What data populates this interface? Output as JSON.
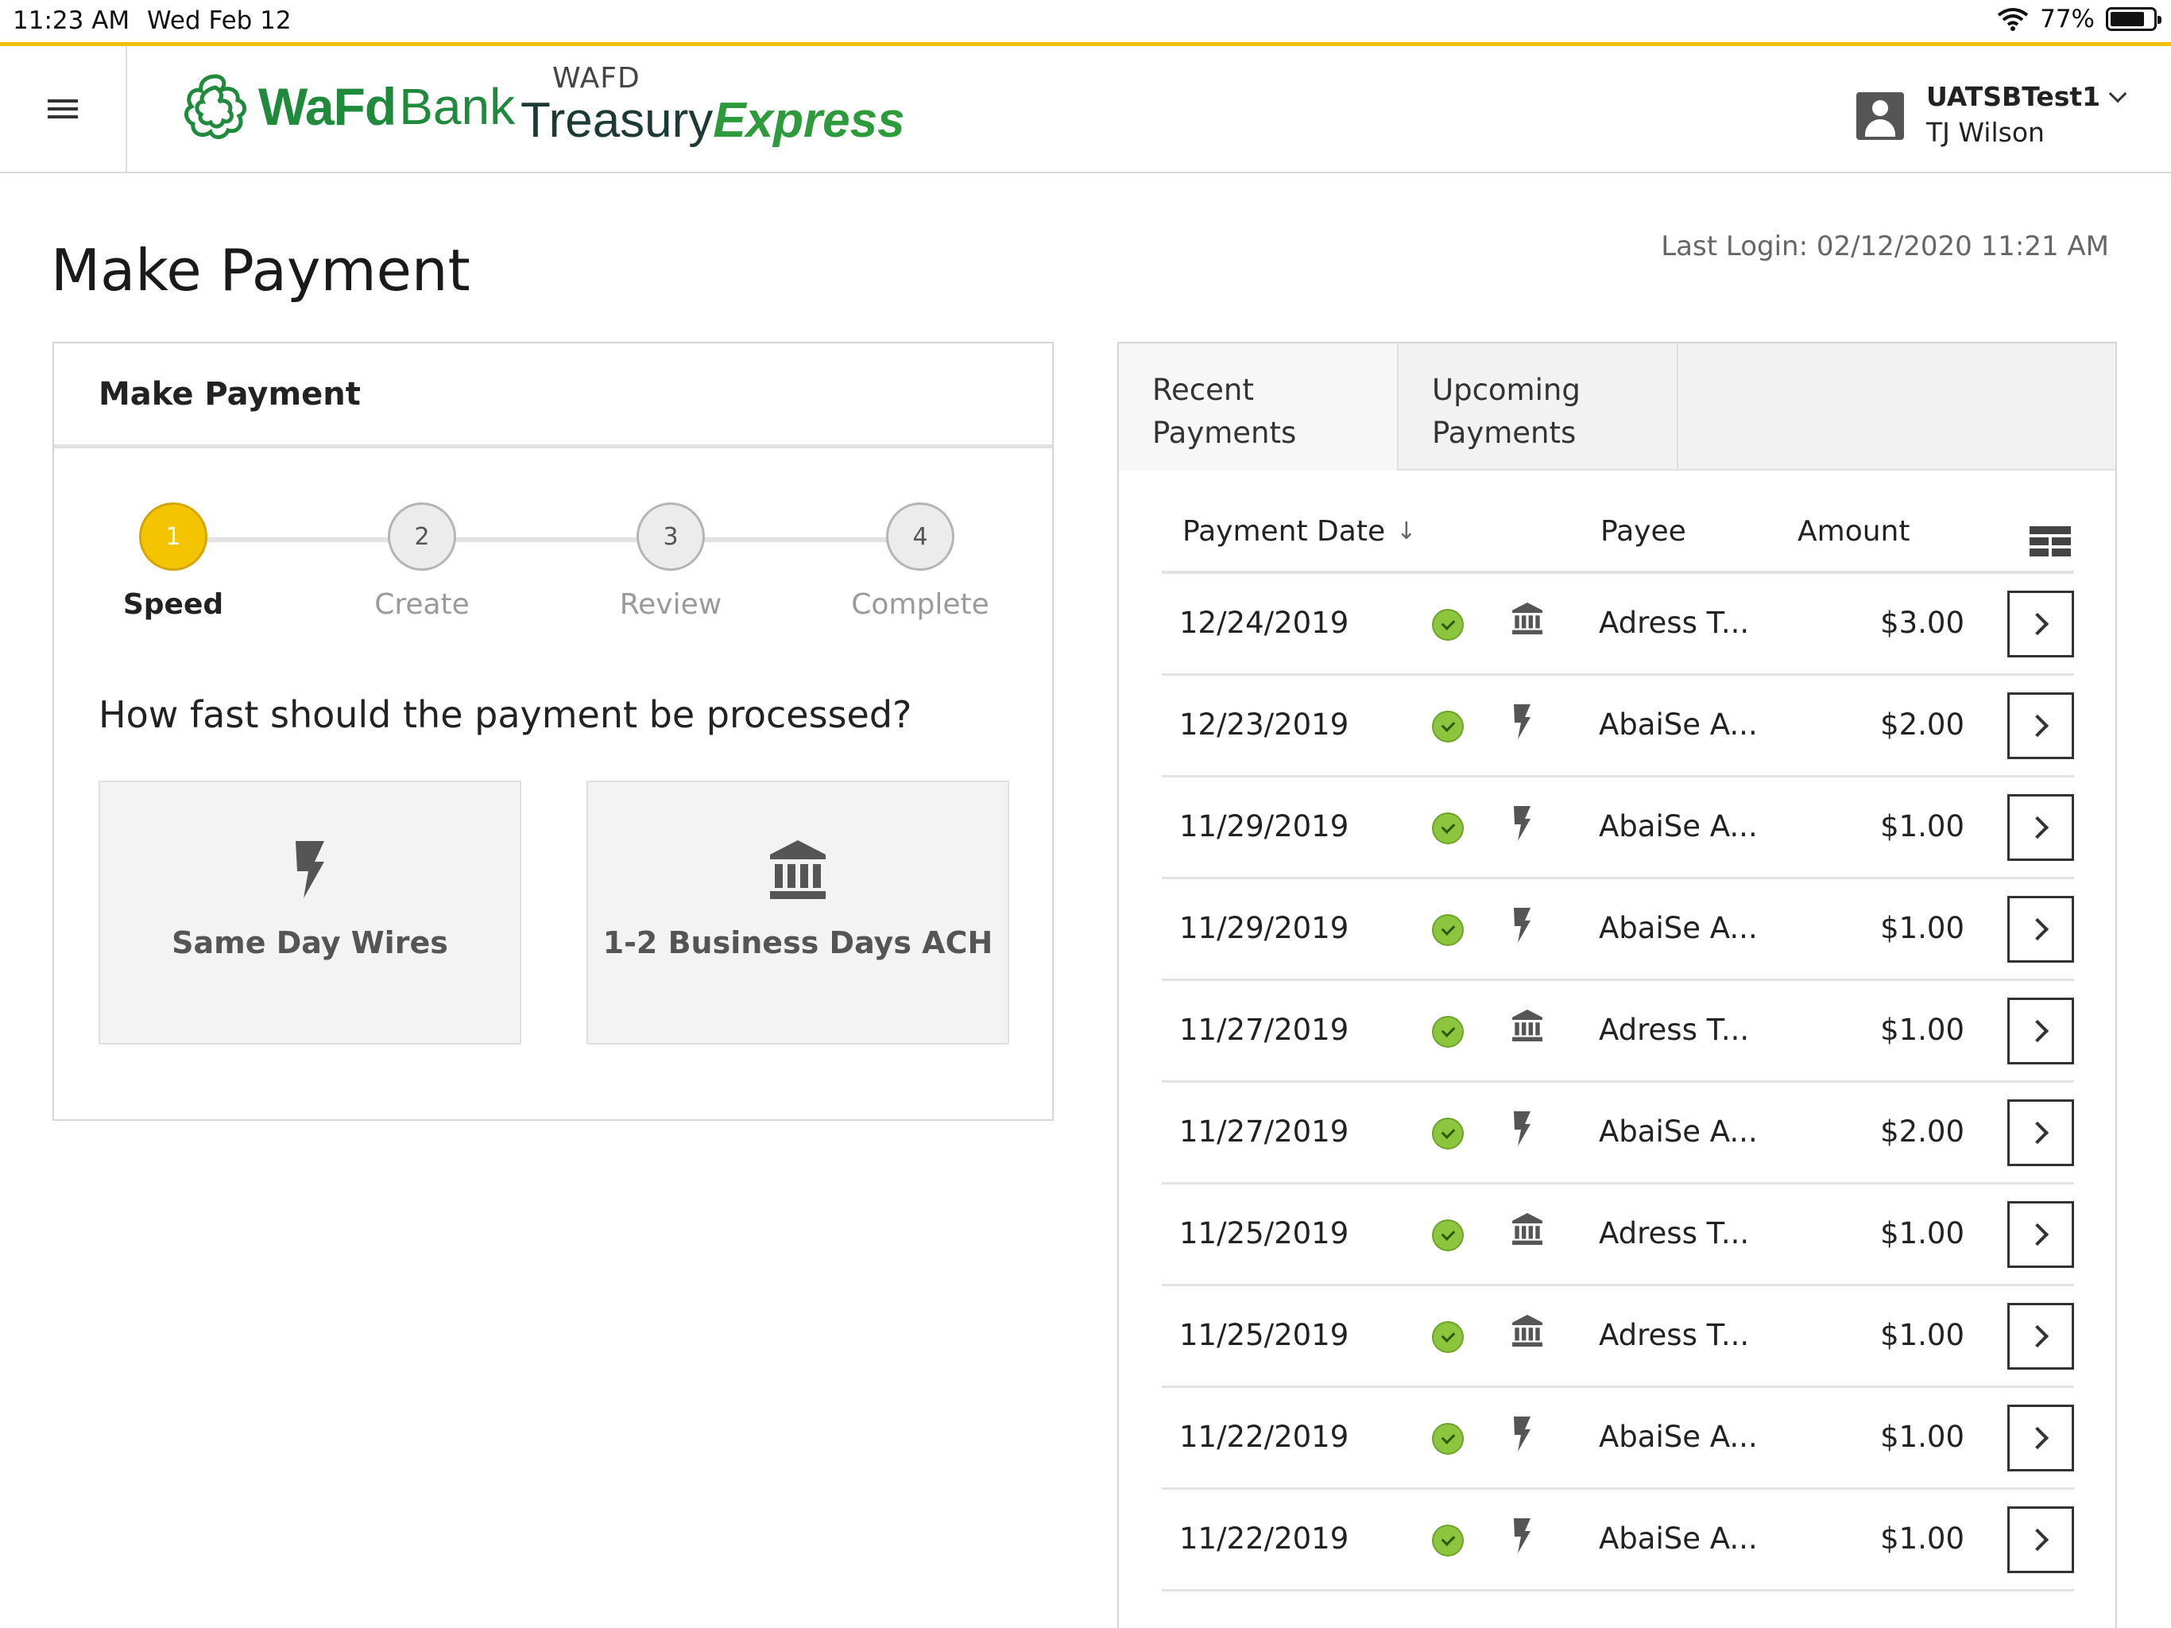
{
  "status_bar": {
    "time": "11:23 AM",
    "date": "Wed Feb 12",
    "battery": "77%"
  },
  "header": {
    "logo_wafd": "WaFd",
    "logo_bank": "Bank",
    "treasury_small": "WAFD",
    "treasury_main": "Treasury",
    "treasury_express": "Express",
    "user_id": "UATSBTest1",
    "user_name": "TJ Wilson"
  },
  "page": {
    "title": "Make Payment",
    "last_login": "Last Login: 02/12/2020 11:21 AM"
  },
  "make_payment_card": {
    "title": "Make Payment",
    "steps": [
      {
        "number": "1",
        "label": "Speed",
        "active": true
      },
      {
        "number": "2",
        "label": "Create",
        "active": false
      },
      {
        "number": "3",
        "label": "Review",
        "active": false
      },
      {
        "number": "4",
        "label": "Complete",
        "active": false
      }
    ],
    "question": "How fast should the payment be processed?",
    "options": [
      {
        "label": "Same Day Wires",
        "icon": "lightning-icon"
      },
      {
        "label": "1-2 Business Days ACH",
        "icon": "bank-icon"
      }
    ]
  },
  "payments_panel": {
    "tabs": [
      {
        "line1": "Recent",
        "line2": "Payments"
      },
      {
        "line1": "Upcoming",
        "line2": "Payments"
      }
    ],
    "columns": {
      "date": "Payment Date",
      "payee": "Payee",
      "amount": "Amount"
    },
    "rows": [
      {
        "date": "12/24/2019",
        "type": "bank-icon",
        "payee": "Adress T...",
        "amount": "$3.00"
      },
      {
        "date": "12/23/2019",
        "type": "lightning-icon",
        "payee": "AbaiSe A...",
        "amount": "$2.00"
      },
      {
        "date": "11/29/2019",
        "type": "lightning-icon",
        "payee": "AbaiSe A...",
        "amount": "$1.00"
      },
      {
        "date": "11/29/2019",
        "type": "lightning-icon",
        "payee": "AbaiSe A...",
        "amount": "$1.00"
      },
      {
        "date": "11/27/2019",
        "type": "bank-icon",
        "payee": "Adress T...",
        "amount": "$1.00"
      },
      {
        "date": "11/27/2019",
        "type": "lightning-icon",
        "payee": "AbaiSe A...",
        "amount": "$2.00"
      },
      {
        "date": "11/25/2019",
        "type": "bank-icon",
        "payee": "Adress T...",
        "amount": "$1.00"
      },
      {
        "date": "11/25/2019",
        "type": "bank-icon",
        "payee": "Adress T...",
        "amount": "$1.00"
      },
      {
        "date": "11/22/2019",
        "type": "lightning-icon",
        "payee": "AbaiSe A...",
        "amount": "$1.00"
      },
      {
        "date": "11/22/2019",
        "type": "lightning-icon",
        "payee": "AbaiSe A...",
        "amount": "$1.00"
      }
    ]
  },
  "colors": {
    "accent_yellow": "#f5c400",
    "brand_green": "#1f8a3c",
    "status_green": "#8cc63f"
  }
}
